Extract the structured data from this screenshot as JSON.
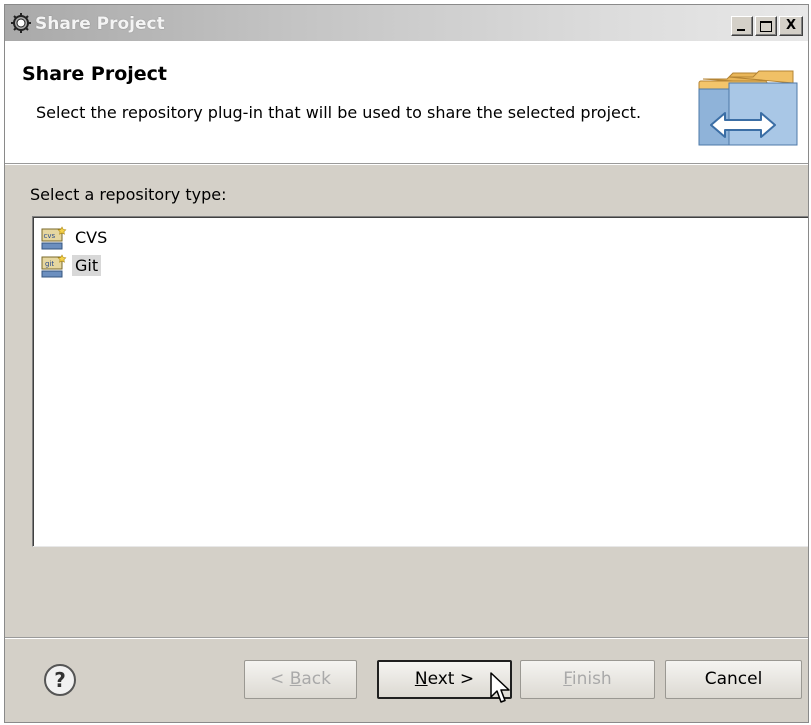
{
  "window": {
    "title": "Share Project",
    "controls": {
      "minimize": "_",
      "maximize": "□",
      "close": "X"
    }
  },
  "banner": {
    "title": "Share Project",
    "description": "Select the repository plug-in that will be used to share the selected project.",
    "icon": "folders-sync-icon"
  },
  "repository_list": {
    "label": "Select a repository type:",
    "items": [
      {
        "label": "CVS",
        "icon": "cvs-repository-icon",
        "selected": false
      },
      {
        "label": "Git",
        "icon": "git-repository-icon",
        "selected": true
      }
    ]
  },
  "buttons": {
    "help_icon": "help-icon",
    "back": {
      "prefix": "< ",
      "mnemonic": "B",
      "rest": "ack",
      "enabled": false
    },
    "next": {
      "mnemonic": "N",
      "rest": "ext >",
      "enabled": true,
      "default": true
    },
    "finish": {
      "mnemonic": "F",
      "rest": "inish",
      "enabled": false
    },
    "cancel": {
      "label": "Cancel",
      "enabled": true
    }
  },
  "colors": {
    "dialog_background": "#d4d0c8",
    "selection": "#d8d8d8",
    "disabled_text": "#a9a9a9"
  }
}
